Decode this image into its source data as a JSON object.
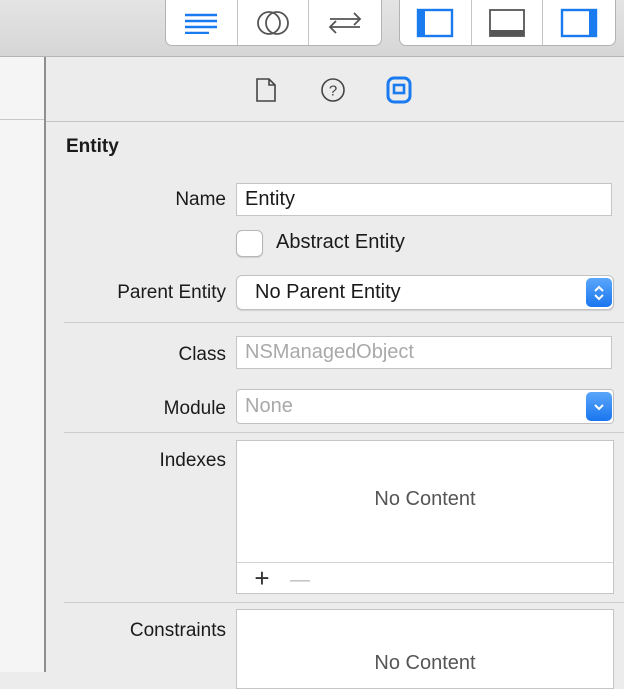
{
  "toolbar": {
    "editor_buttons": [
      {
        "name": "standard-editor-icon",
        "active": true
      },
      {
        "name": "assistant-editor-icon",
        "active": false
      },
      {
        "name": "version-editor-icon",
        "active": false
      }
    ],
    "view_buttons": [
      {
        "name": "navigator-toggle-icon"
      },
      {
        "name": "debug-area-toggle-icon"
      },
      {
        "name": "utilities-toggle-icon"
      }
    ],
    "accent_color": "#1a7af0"
  },
  "inspector_tabs": [
    {
      "name": "file-inspector-icon",
      "active": false
    },
    {
      "name": "quick-help-icon",
      "active": false
    },
    {
      "name": "data-model-inspector-icon",
      "active": true
    }
  ],
  "section": {
    "title": "Entity"
  },
  "name_field": {
    "label": "Name",
    "value": "Entity"
  },
  "abstract_checkbox": {
    "label": "Abstract Entity",
    "checked": false
  },
  "parent_entity": {
    "label": "Parent Entity",
    "selected": "No Parent Entity"
  },
  "class_field": {
    "label": "Class",
    "placeholder": "NSManagedObject"
  },
  "module": {
    "label": "Module",
    "selected": "None"
  },
  "indexes": {
    "label": "Indexes",
    "empty_text": "No Content",
    "add": "+",
    "remove": "—"
  },
  "constraints": {
    "label": "Constraints",
    "empty_text": "No Content"
  }
}
